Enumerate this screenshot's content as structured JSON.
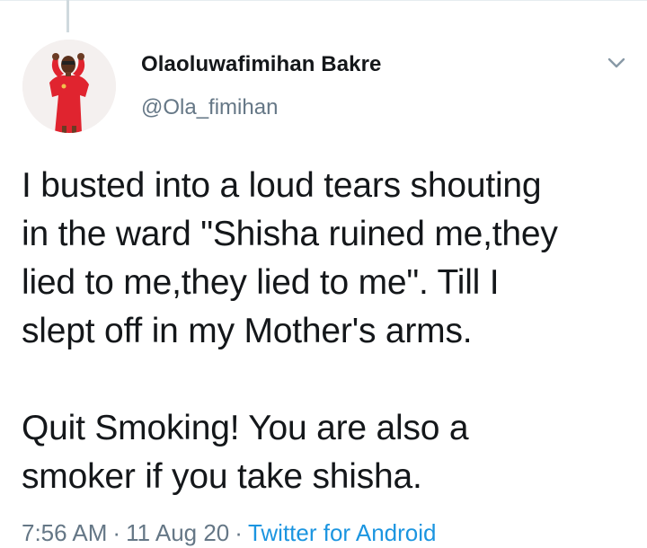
{
  "tweet": {
    "author_name": "Olaoluwafimihan Bakre",
    "author_handle": "@Ola_fimihan",
    "text": "I busted into a loud tears shouting\nin the ward \"Shisha ruined me,they\nlied to me,they lied to me\". Till I\nslept off in my Mother's arms.\n\nQuit Smoking! You are also a\nsmoker if you take shisha.",
    "time": "7:56 AM",
    "date": "11 Aug 20",
    "source": "Twitter for Android",
    "separator": "·"
  },
  "icons": {
    "menu": "chevron-down-icon",
    "avatar": "profile-photo"
  },
  "colors": {
    "text": "#14171a",
    "secondary": "#657786",
    "link": "#1b95e0",
    "avatar_dress": "#e0242f"
  }
}
